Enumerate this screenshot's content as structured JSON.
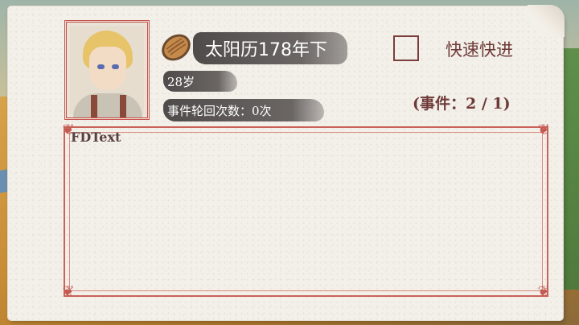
{
  "header": {
    "date_title": "太阳历178年下",
    "age": "28岁",
    "cycle_count": "事件轮回次数：0次"
  },
  "fast_forward": {
    "label": "快速快进",
    "checked": false
  },
  "events_counter": "(事件：2 / 1)",
  "text_area": {
    "content": "FDText"
  },
  "colors": {
    "accent": "#c96258",
    "dark_text": "#6e3a38",
    "brush": "#5a5553",
    "paper": "#f3efe9"
  },
  "icons": [
    "bread-icon",
    "portrait-avatar"
  ]
}
